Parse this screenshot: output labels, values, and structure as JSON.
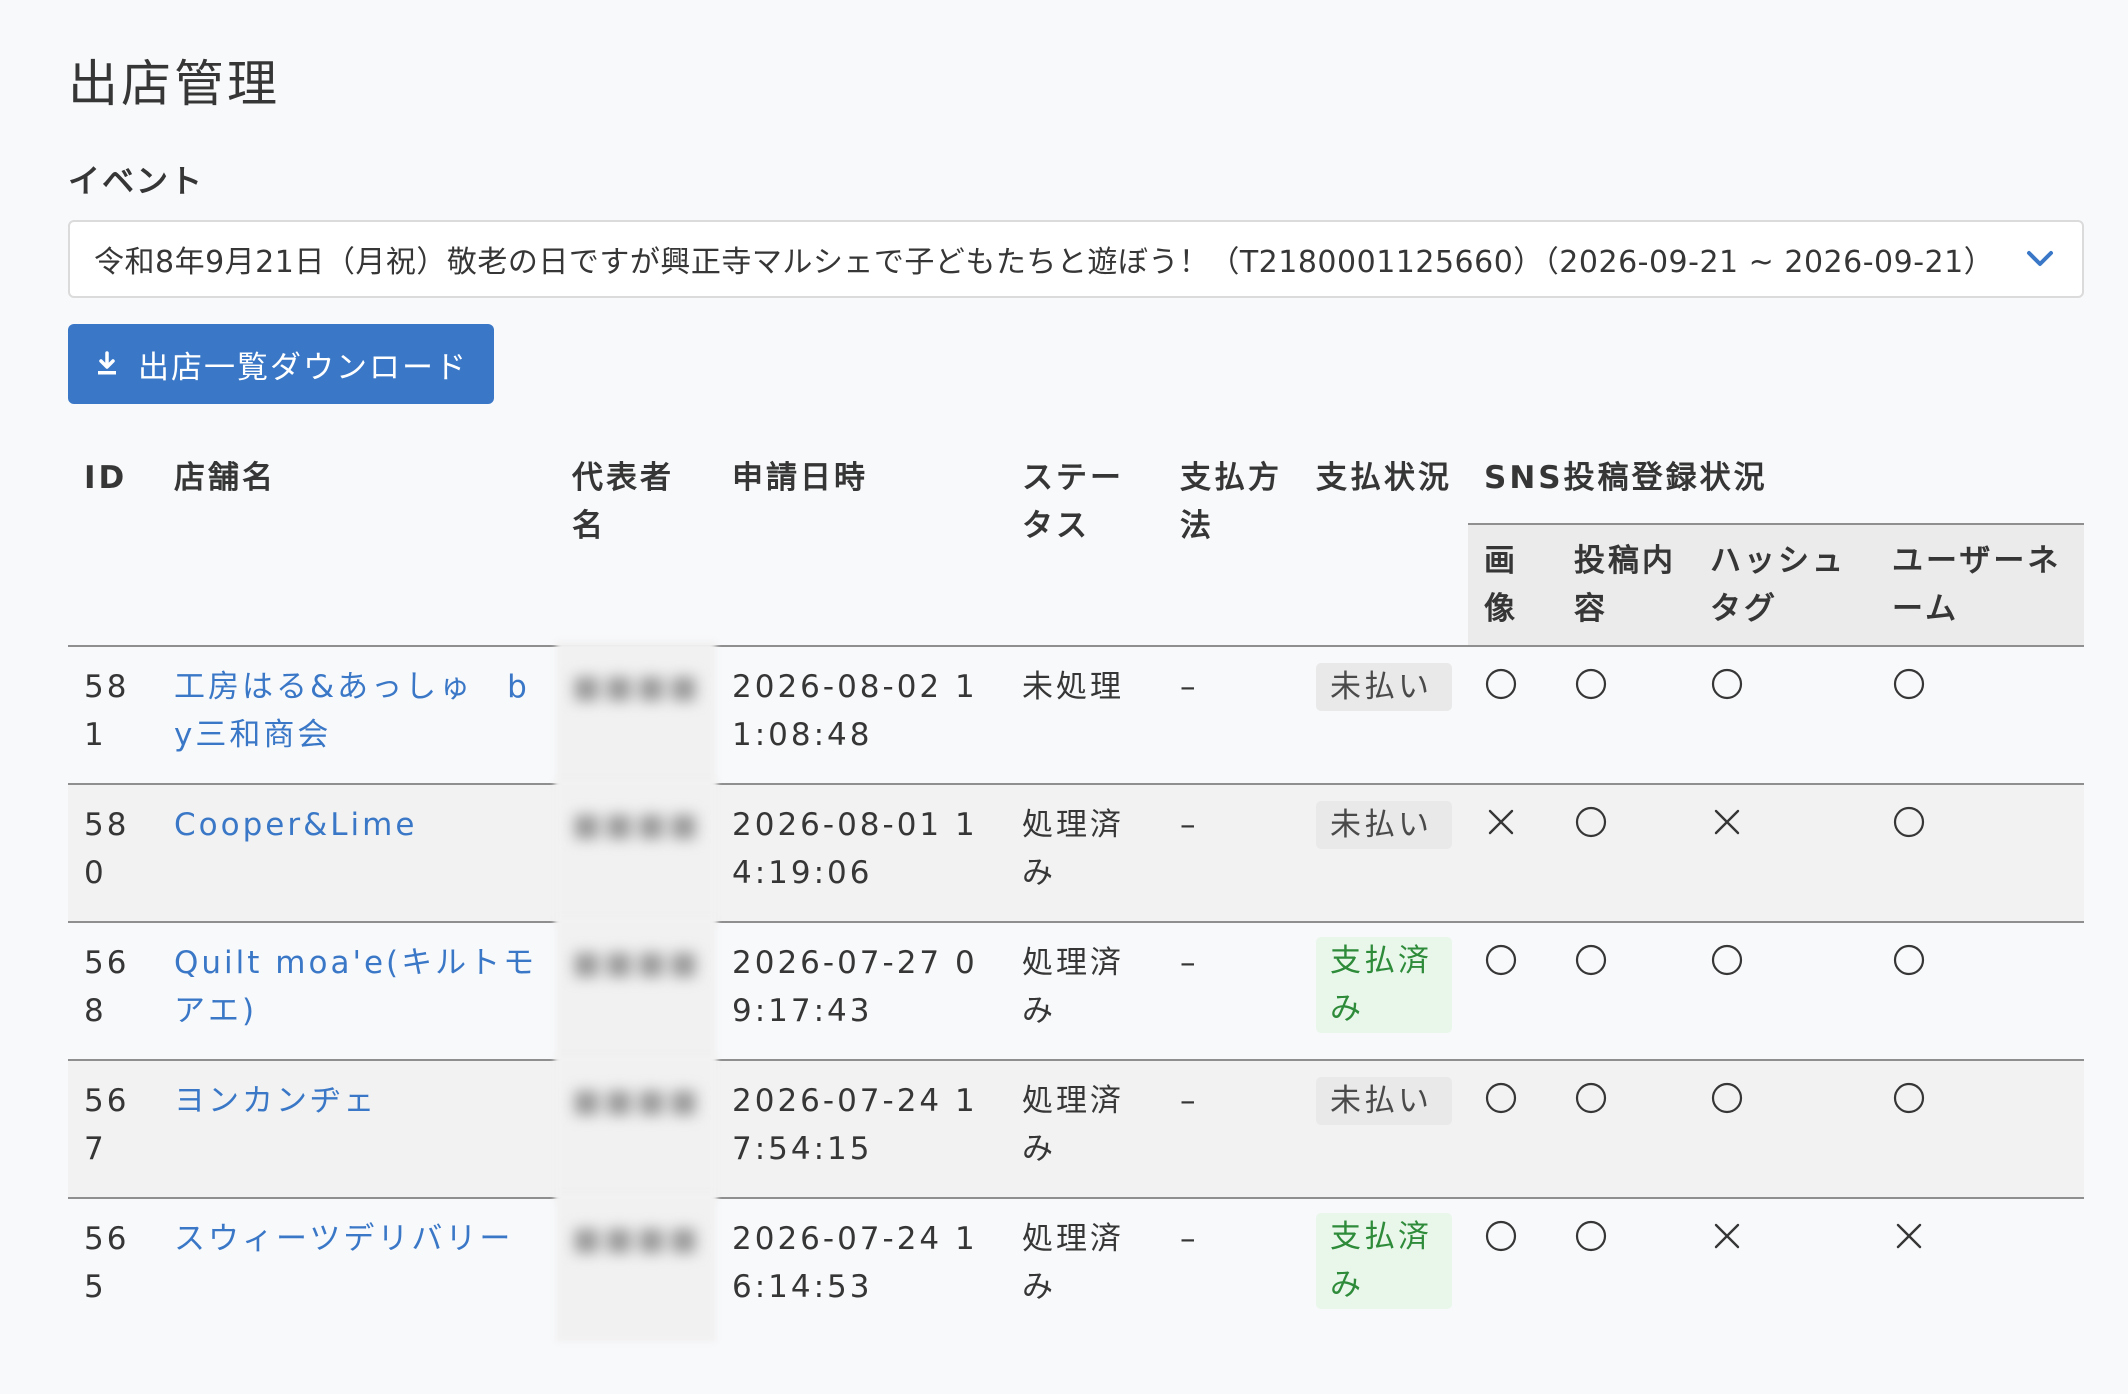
{
  "page_title": "出店管理",
  "event_label": "イベント",
  "event_select": {
    "selected": "令和8年9月21日（月祝）敬老の日ですが興正寺マルシェで子どもたちと遊ぼう！（T2180001125660）（2026-09-21 ~ 2026-09-21）"
  },
  "download_button": {
    "label": "出店一覧ダウンロード"
  },
  "table": {
    "headers": {
      "id": "ID",
      "shop_name": "店舗名",
      "representative": "代表者名",
      "applied_at": "申請日時",
      "status": "ステータス",
      "payment_method": "支払方法",
      "payment_status": "支払状況",
      "sns_group": "SNS投稿登録状況",
      "sns_image": "画像",
      "sns_content": "投稿内容",
      "sns_hashtag": "ハッシュタグ",
      "sns_username": "ユーザーネーム"
    },
    "rows": [
      {
        "id": "581",
        "shop_name": "工房はる&あっしゅ　by三和商会",
        "representative": "■■■■",
        "applied_at": "2026-08-02 11:08:48",
        "status": "未処理",
        "payment_method": "–",
        "payment_status": "未払い",
        "payment_state": "unpaid",
        "sns": {
          "image": "○",
          "content": "○",
          "hashtag": "○",
          "username": "○"
        }
      },
      {
        "id": "580",
        "shop_name": "Cooper&Lime",
        "representative": "■■■■",
        "applied_at": "2026-08-01 14:19:06",
        "status": "処理済み",
        "payment_method": "–",
        "payment_status": "未払い",
        "payment_state": "unpaid",
        "sns": {
          "image": "×",
          "content": "○",
          "hashtag": "×",
          "username": "○"
        }
      },
      {
        "id": "568",
        "shop_name": "Quilt moa'e(キルトモアエ)",
        "representative": "■■■■",
        "applied_at": "2026-07-27 09:17:43",
        "status": "処理済み",
        "payment_method": "–",
        "payment_status": "支払済み",
        "payment_state": "paid",
        "sns": {
          "image": "○",
          "content": "○",
          "hashtag": "○",
          "username": "○"
        }
      },
      {
        "id": "567",
        "shop_name": "ヨンカンヂェ",
        "representative": "■■■■",
        "applied_at": "2026-07-24 17:54:15",
        "status": "処理済み",
        "payment_method": "–",
        "payment_status": "未払い",
        "payment_state": "unpaid",
        "sns": {
          "image": "○",
          "content": "○",
          "hashtag": "○",
          "username": "○"
        }
      },
      {
        "id": "565",
        "shop_name": "スウィーツデリバリー",
        "representative": "■■■■",
        "applied_at": "2026-07-24 16:14:53",
        "status": "処理済み",
        "payment_method": "–",
        "payment_status": "支払済み",
        "payment_state": "paid",
        "sns": {
          "image": "○",
          "content": "○",
          "hashtag": "×",
          "username": "×"
        }
      }
    ]
  },
  "colors": {
    "primary": "#3a78c7",
    "paid_bg": "#e8f7ea",
    "paid_text": "#2e8b3a",
    "unpaid_bg": "#e9e9e9"
  }
}
